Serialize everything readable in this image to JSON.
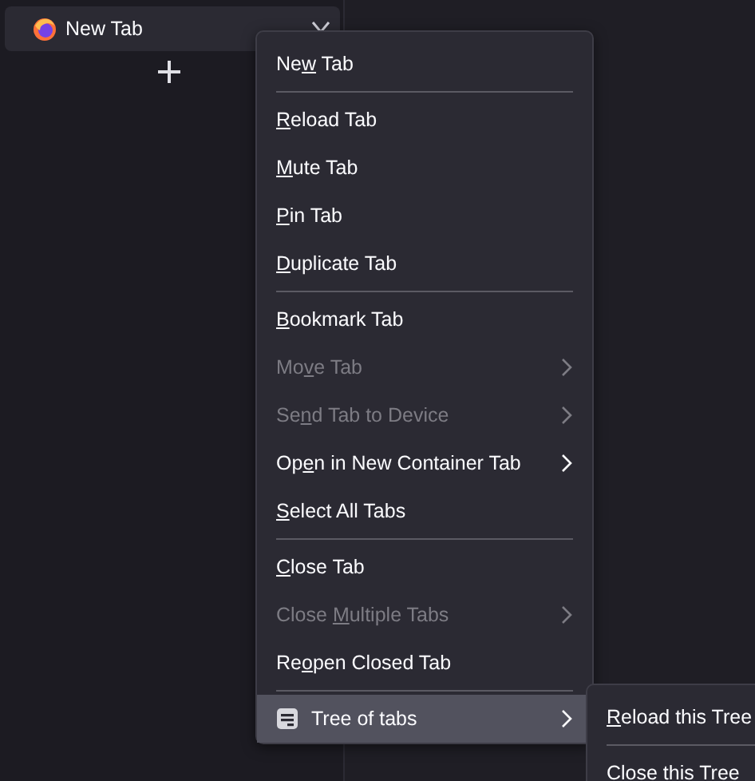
{
  "tab": {
    "title": "New Tab"
  },
  "context_menu": {
    "items": [
      {
        "kind": "item",
        "label": {
          "before": "Ne",
          "key": "w",
          "after": " Tab"
        },
        "disabled": false,
        "submenu": false,
        "highlighted": false
      },
      {
        "kind": "separator"
      },
      {
        "kind": "item",
        "label": {
          "key": "R",
          "after": "eload Tab"
        },
        "disabled": false,
        "submenu": false,
        "highlighted": false
      },
      {
        "kind": "item",
        "label": {
          "key": "M",
          "after": "ute Tab"
        },
        "disabled": false,
        "submenu": false,
        "highlighted": false
      },
      {
        "kind": "item",
        "label": {
          "key": "P",
          "after": "in Tab"
        },
        "disabled": false,
        "submenu": false,
        "highlighted": false
      },
      {
        "kind": "item",
        "label": {
          "key": "D",
          "after": "uplicate Tab"
        },
        "disabled": false,
        "submenu": false,
        "highlighted": false
      },
      {
        "kind": "separator"
      },
      {
        "kind": "item",
        "label": {
          "key": "B",
          "after": "ookmark Tab"
        },
        "disabled": false,
        "submenu": false,
        "highlighted": false
      },
      {
        "kind": "item",
        "label": {
          "before": "Mo",
          "key": "v",
          "after": "e Tab"
        },
        "disabled": true,
        "submenu": true,
        "highlighted": false
      },
      {
        "kind": "item",
        "label": {
          "before": "Se",
          "key": "n",
          "after": "d Tab to Device"
        },
        "disabled": true,
        "submenu": true,
        "highlighted": false
      },
      {
        "kind": "item",
        "label": {
          "before": "Op",
          "key": "e",
          "after": "n in New Container Tab"
        },
        "disabled": false,
        "submenu": true,
        "highlighted": false
      },
      {
        "kind": "item",
        "label": {
          "key": "S",
          "after": "elect All Tabs"
        },
        "disabled": false,
        "submenu": false,
        "highlighted": false
      },
      {
        "kind": "separator"
      },
      {
        "kind": "item",
        "label": {
          "key": "C",
          "after": "lose Tab"
        },
        "disabled": false,
        "submenu": false,
        "highlighted": false
      },
      {
        "kind": "item",
        "label": {
          "before": "Close ",
          "key": "M",
          "after": "ultiple Tabs"
        },
        "disabled": true,
        "submenu": true,
        "highlighted": false
      },
      {
        "kind": "item",
        "label": {
          "before": "Re",
          "key": "o",
          "after": "pen Closed Tab"
        },
        "disabled": false,
        "submenu": false,
        "highlighted": false
      },
      {
        "kind": "separator"
      },
      {
        "kind": "extension",
        "label": {
          "before": "Tree of tabs"
        },
        "disabled": false,
        "submenu": true,
        "highlighted": true
      }
    ]
  },
  "submenu": {
    "items": [
      {
        "kind": "item",
        "label": {
          "key": "R",
          "after": "eload this Tree"
        },
        "disabled": false,
        "highlighted": false
      },
      {
        "kind": "separator"
      },
      {
        "kind": "item",
        "label": {
          "before": "Close this Tree"
        },
        "disabled": false,
        "highlighted": false
      }
    ]
  }
}
